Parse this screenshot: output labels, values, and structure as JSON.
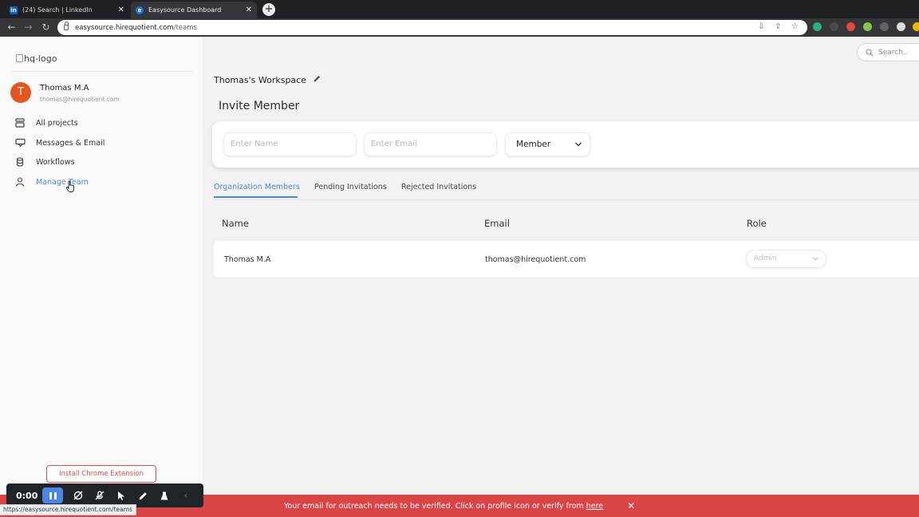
{
  "browser": {
    "tabs": [
      {
        "title": "(24) Search | LinkedIn",
        "favicon": "linkedin-icon"
      },
      {
        "title": "Easysource Dashboard",
        "favicon": "easysource-icon",
        "active": true
      }
    ],
    "url_domain": "easysource.hirequotient.com",
    "url_path": "/teams",
    "status_url": "https://easysource.hirequotient.com/teams"
  },
  "sidebar": {
    "logo_alt": "hq-logo",
    "user": {
      "initial": "T",
      "name": "Thomas M.A",
      "email": "thomas@hirequotient.com"
    },
    "nav": [
      {
        "label": "All projects",
        "icon": "projects-icon"
      },
      {
        "label": "Messages & Email",
        "icon": "messages-icon"
      },
      {
        "label": "Workflows",
        "icon": "workflows-icon"
      },
      {
        "label": "Manage Team",
        "icon": "person-icon",
        "active": true
      }
    ],
    "install_label": "Install Chrome Extension"
  },
  "header": {
    "search_placeholder": "Search.."
  },
  "workspace": {
    "title": "Thomas's Workspace"
  },
  "invite": {
    "title": "Invite Member",
    "name_placeholder": "Enter Name",
    "email_placeholder": "Enter Email",
    "role_selected": "Member"
  },
  "tabs": {
    "items": [
      "Organization Members",
      "Pending Invitations",
      "Rejected Invitations"
    ],
    "active_index": 0
  },
  "table": {
    "columns": [
      "Name",
      "Email",
      "Role"
    ],
    "rows": [
      {
        "name": "Thomas M.A",
        "email": "thomas@hirequotient.com",
        "role": "Admin"
      }
    ]
  },
  "banner": {
    "text": "Your email for outreach needs to be verified. Click on profile icon or verify from",
    "link": "here"
  },
  "recorder": {
    "time": "0:00"
  },
  "colors": {
    "accent": "#4a86e8",
    "banner": "#d94545",
    "avatar": "#e8541e"
  }
}
